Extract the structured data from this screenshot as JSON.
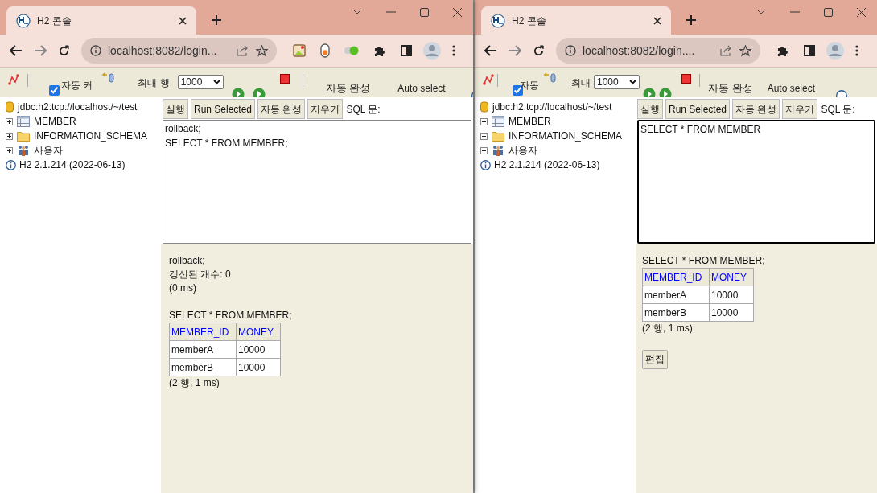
{
  "windows": [
    {
      "tab_title": "H2 콘솔",
      "url": "localhost:8082/login...",
      "extension_icons": [
        {
          "kind": "image"
        },
        {
          "kind": "toggle"
        },
        {
          "kind": "js"
        },
        {
          "kind": "puzzle"
        },
        {
          "kind": "sidebar"
        }
      ],
      "toolbar": {
        "autocommit_label": "자동 커",
        "autocommit_checked": true,
        "max_rows_label": "최대 행",
        "max_rows_value": "1000",
        "autocomplete_label": "자동 완성",
        "auto_select_label": "Auto select"
      },
      "tree": {
        "connection": "jdbc:h2:tcp://localhost/~/test",
        "items": [
          {
            "kind": "table",
            "label": "MEMBER"
          },
          {
            "kind": "folder",
            "label": "INFORMATION_SCHEMA"
          },
          {
            "kind": "users",
            "label": "사용자"
          }
        ],
        "version": "H2 2.1.214 (2022-06-13)"
      },
      "query_buttons": [
        "실행",
        "Run Selected",
        "자동 완성",
        "지우기"
      ],
      "sql_label": "SQL 문:",
      "editor": {
        "lines": [
          "rollback;",
          "SELECT * FROM MEMBER;"
        ],
        "focused": false
      },
      "results": [
        {
          "kind": "text",
          "lines": [
            "rollback;",
            "갱신된 개수: 0",
            "(0 ms)"
          ]
        },
        {
          "kind": "text",
          "lines": [
            "SELECT * FROM MEMBER;"
          ]
        },
        {
          "kind": "table",
          "columns": [
            "MEMBER_ID",
            "MONEY"
          ],
          "rows": [
            [
              "memberA",
              "10000"
            ],
            [
              "memberB",
              "10000"
            ]
          ]
        },
        {
          "kind": "text",
          "lines": [
            "(2 행, 1 ms)"
          ]
        }
      ]
    },
    {
      "tab_title": "H2 콘솔",
      "url": "localhost:8082/login....",
      "extension_icons": [
        {
          "kind": "puzzle"
        },
        {
          "kind": "sidebar"
        }
      ],
      "toolbar": {
        "autocommit_label": "자동",
        "autocommit_checked": true,
        "max_rows_label": "최대",
        "max_rows_value": "1000",
        "autocomplete_label": "자동 완성",
        "auto_select_label": "Auto select"
      },
      "tree": {
        "connection": "jdbc:h2:tcp://localhost/~/test",
        "items": [
          {
            "kind": "table",
            "label": "MEMBER"
          },
          {
            "kind": "folder",
            "label": "INFORMATION_SCHEMA"
          },
          {
            "kind": "users",
            "label": "사용자"
          }
        ],
        "version": "H2 2.1.214 (2022-06-13)"
      },
      "query_buttons": [
        "실행",
        "Run Selected",
        "자동 완성",
        "지우기"
      ],
      "sql_label": "SQL 문:",
      "editor": {
        "lines": [
          "SELECT * FROM MEMBER"
        ],
        "focused": true
      },
      "results": [
        {
          "kind": "text",
          "lines": [
            "SELECT * FROM MEMBER;"
          ]
        },
        {
          "kind": "table",
          "columns": [
            "MEMBER_ID",
            "MONEY"
          ],
          "rows": [
            [
              "memberA",
              "10000"
            ],
            [
              "memberB",
              "10000"
            ]
          ]
        },
        {
          "kind": "text",
          "lines": [
            "(2 행, 1 ms)"
          ]
        },
        {
          "kind": "button",
          "label": "편집"
        }
      ]
    }
  ]
}
